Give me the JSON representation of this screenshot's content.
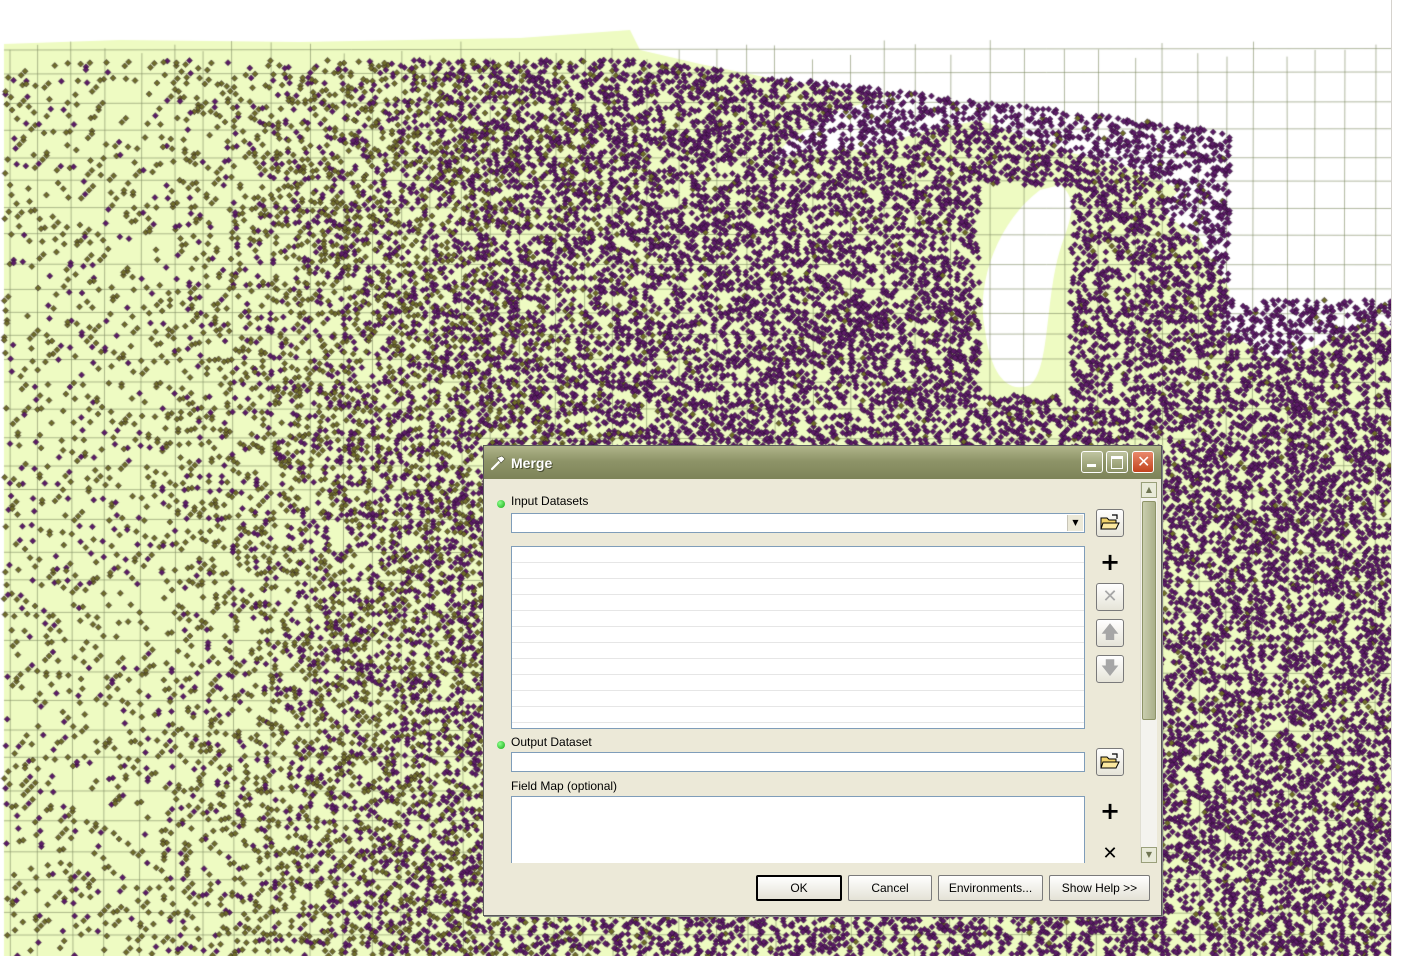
{
  "map": {
    "colors": {
      "background": "#ffffff",
      "land": "#eefbc2",
      "county_lines": "#7e8a62",
      "point_purple": "#5b1c66",
      "point_olive": "#6f6d2a",
      "point_outline": "#1e0b22"
    }
  },
  "dialog": {
    "title": "Merge",
    "title_icon": "hammer-icon",
    "input_datasets_label": "Input Datasets",
    "input_datasets_value": "",
    "output_dataset_label": "Output Dataset",
    "output_dataset_value": "",
    "field_map_label": "Field Map (optional)",
    "side_icons": [
      "open-folder-icon",
      "plus-icon",
      "delete-icon",
      "move-up-icon",
      "move-down-icon",
      "open-folder-icon",
      "plus-icon",
      "delete-icon"
    ],
    "buttons": {
      "ok": "OK",
      "cancel": "Cancel",
      "environments": "Environments...",
      "show_help": "Show Help >>"
    }
  }
}
